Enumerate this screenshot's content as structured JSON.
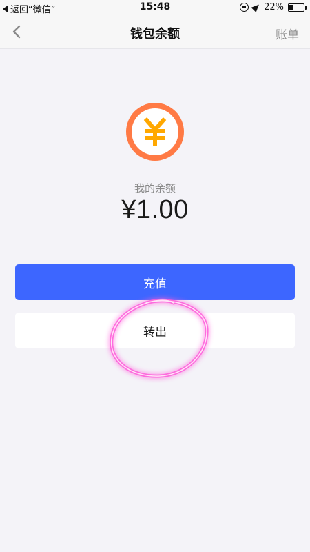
{
  "status_bar": {
    "back_app": "返回“微信”",
    "time": "15:48",
    "battery": "22%"
  },
  "nav": {
    "title": "钱包余额",
    "right_action": "账单",
    "back_icon": "chevron-left-icon"
  },
  "coin_icon": {
    "name": "yuan-coin-icon",
    "symbol": "¥",
    "ring_color": "#ff7a45",
    "symbol_color": "#ffa800"
  },
  "balance": {
    "label": "我的余额",
    "amount": "¥1.00"
  },
  "actions": {
    "recharge_label": "充值",
    "recharge_color": "#3d66ff",
    "transfer_label": "转出"
  },
  "annotation": {
    "shape": "hand-drawn circle",
    "color": "#ff4fd8"
  }
}
